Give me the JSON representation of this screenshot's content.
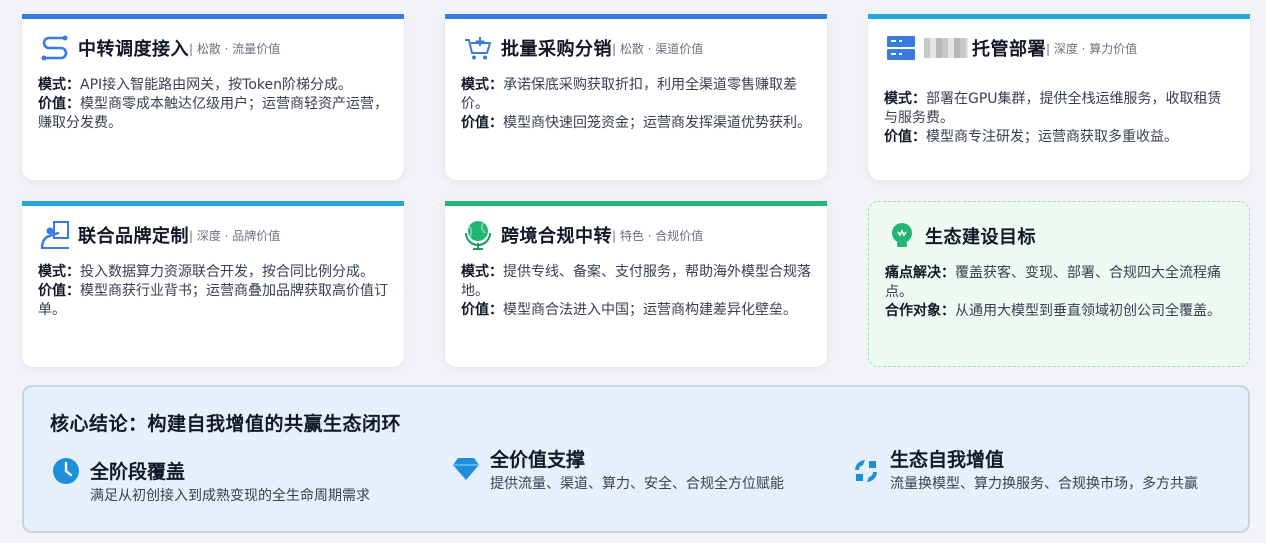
{
  "cards": [
    {
      "title": "中转调度接入",
      "tag": "| 松散 · 流量价值",
      "icon": "route-icon",
      "color": "#3a7be0",
      "mode_label": "模式：",
      "mode": "API接入智能路由网关，按Token阶梯分成。",
      "value_label": "价值：",
      "value": "模型商零成本触达亿级用户；运营商轻资产运营，赚取分发费。"
    },
    {
      "title": "批量采购分销",
      "tag": "| 松散 · 渠道价值",
      "icon": "cart-icon",
      "color": "#3a7be0",
      "mode_label": "模式：",
      "mode": "承诺保底采购获取折扣，利用全渠道零售赚取差价。",
      "value_label": "价值：",
      "value": "模型商快速回笼资金；运营商发挥渠道优势获利。"
    },
    {
      "title": "托管部署",
      "tag": "| 深度 · 算力价值",
      "icon": "server-icon",
      "color": "#22a7d8",
      "mode_label": "模式：",
      "mode": "部署在GPU集群，提供全栈运维服务，收取租赁与服务费。",
      "value_label": "价值：",
      "value": "模型商专注研发；运营商获取多重收益。"
    },
    {
      "title": "联合品牌定制",
      "tag": "| 深度 · 品牌价值",
      "icon": "person-board-icon",
      "color": "#22a7d8",
      "mode_label": "模式：",
      "mode": "投入数据算力资源联合开发，按合同比例分成。",
      "value_label": "价值：",
      "value": "模型商获行业背书；运营商叠加品牌获取高价值订单。"
    },
    {
      "title": "跨境合规中转",
      "tag": "| 特色 · 合规价值",
      "icon": "globe-icon",
      "color": "#22b573",
      "mode_label": "模式：",
      "mode": "提供专线、备案、支付服务，帮助海外模型合规落地。",
      "value_label": "价值：",
      "value": "模型商合法进入中国；运营商构建差异化壁垒。"
    }
  ],
  "goal": {
    "title": "生态建设目标",
    "icon": "lightbulb-icon",
    "pain_label": "痛点解决：",
    "pain": "覆盖获客、变现、部署、合规四大全流程痛点。",
    "target_label": "合作对象：",
    "target": "从通用大模型到垂直领域初创公司全覆盖。"
  },
  "summary": {
    "title": "核心结论：构建自我增值的共赢生态闭环",
    "points": [
      {
        "icon": "clock-icon",
        "title": "全阶段覆盖",
        "desc": "满足从初创接入到成熟变现的全生命周期需求"
      },
      {
        "icon": "diamond-icon",
        "title": "全价值支撑",
        "desc": "提供流量、渠道、算力、安全、合规全方位赋能"
      },
      {
        "icon": "cycle-icon",
        "title": "生态自我增值",
        "desc": "流量换模型、算力换服务、合规换市场，多方共赢"
      }
    ]
  },
  "colors": {
    "blue": "#3a7be0",
    "cyan": "#22a7d8",
    "green": "#22b573",
    "summary_bg": "#e6f0fb"
  }
}
